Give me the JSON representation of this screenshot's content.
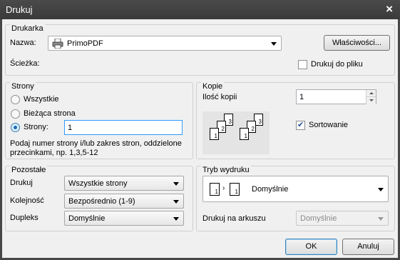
{
  "window": {
    "title": "Drukuj",
    "close": "×"
  },
  "printer": {
    "group_title": "Drukarka",
    "name_label": "Nazwa:",
    "name_value": "PrimoPDF",
    "path_label": "Ścieżka:",
    "properties_button": "Właściwości...",
    "print_to_file_label": "Drukuj do pliku",
    "print_to_file_checked": false
  },
  "pages": {
    "group_title": "Strony",
    "all_label": "Wszystkie",
    "current_label": "Bieżąca strona",
    "pages_label": "Strony:",
    "pages_value": "1",
    "selected": "pages",
    "hint": "Podaj numer strony i/lub zakres stron, oddzielone przecinkami, np. 1,3,5-12"
  },
  "copies": {
    "group_title": "Kopie",
    "count_label": "Ilość kopii",
    "count_value": "1",
    "collate_label": "Sortowanie",
    "collate_checked": true,
    "preview_pages": [
      "1",
      "2",
      "3",
      "1",
      "2",
      "3"
    ]
  },
  "other": {
    "group_title": "Pozostałe",
    "print_label": "Drukuj",
    "print_value": "Wszystkie strony",
    "order_label": "Kolejność",
    "order_value": "Bezpośrednio (1-9)",
    "duplex_label": "Dupleks",
    "duplex_value": "Domyślnie"
  },
  "print_mode": {
    "group_title": "Tryb wydruku",
    "mode_value": "Domyślnie",
    "mode_pages": [
      "1",
      "1"
    ],
    "per_sheet_label": "Drukuj na arkuszu",
    "per_sheet_value": "Domyślnie"
  },
  "buttons": {
    "ok": "OK",
    "cancel": "Anuluj"
  }
}
